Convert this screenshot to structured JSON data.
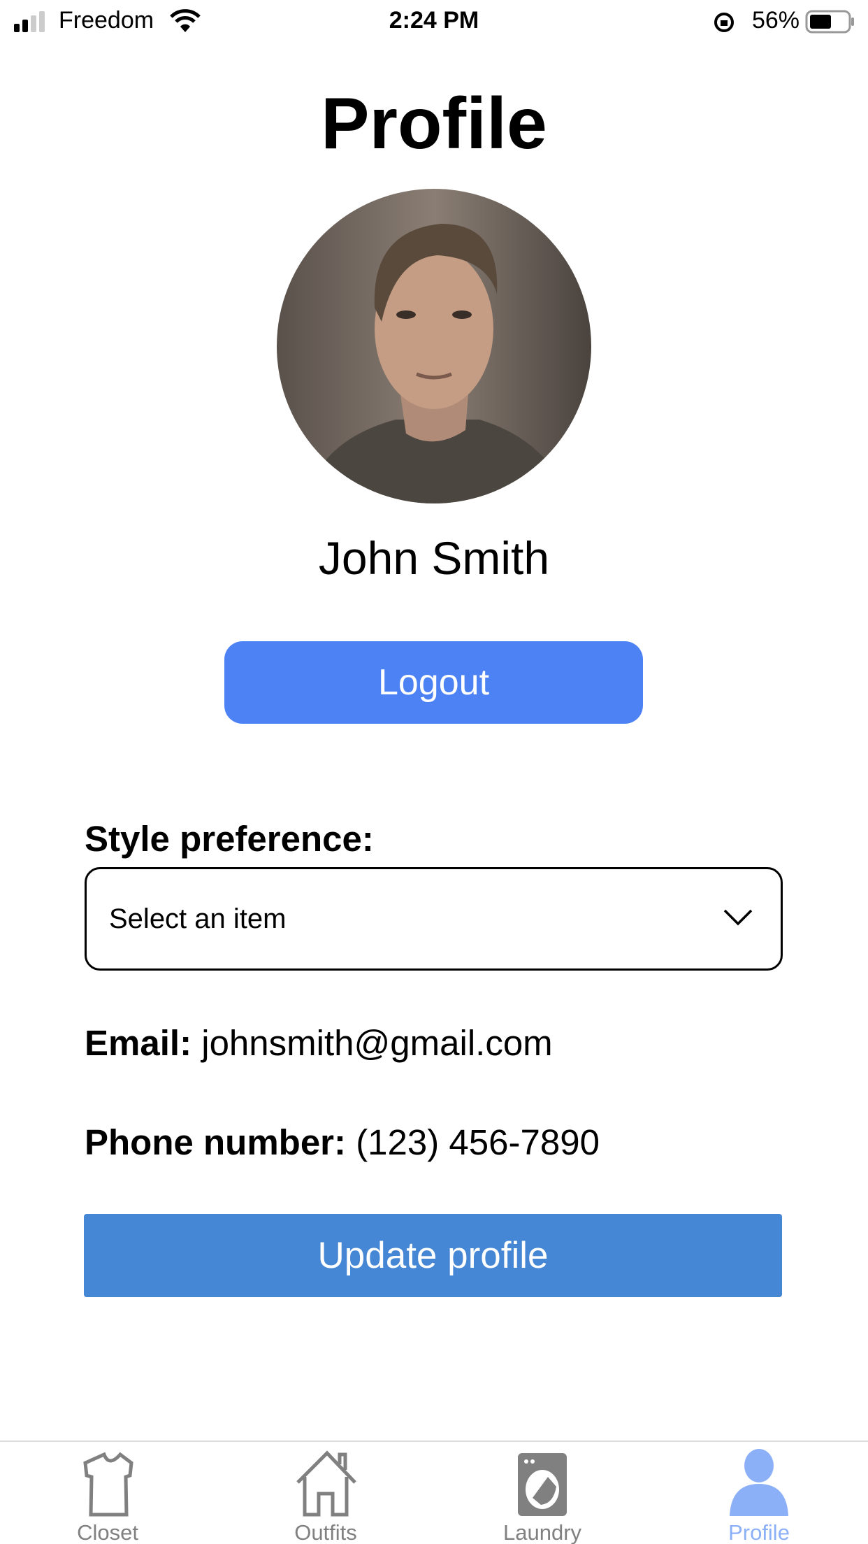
{
  "status_bar": {
    "carrier": "Freedom",
    "time": "2:24 PM",
    "battery": "56%",
    "battery_level": 0.56
  },
  "header": {
    "title": "Profile"
  },
  "profile": {
    "name": "John Smith",
    "logout_label": "Logout"
  },
  "style": {
    "label": "Style preference:",
    "placeholder": "Select an item"
  },
  "email": {
    "label": "Email:",
    "value": "johnsmith@gmail.com"
  },
  "phone": {
    "label": "Phone number:",
    "value": "(123) 456-7890"
  },
  "update_label": "Update profile",
  "tabs": [
    {
      "label": "Closet",
      "icon": "shirt-icon"
    },
    {
      "label": "Outfits",
      "icon": "house-icon"
    },
    {
      "label": "Laundry",
      "icon": "washing-machine-icon"
    },
    {
      "label": "Profile",
      "icon": "person-icon",
      "active": true
    }
  ],
  "colors": {
    "logout": "#4d82f5",
    "update": "#4587d5",
    "tab_active": "#8cb0f8",
    "tab_inactive": "#808080"
  }
}
